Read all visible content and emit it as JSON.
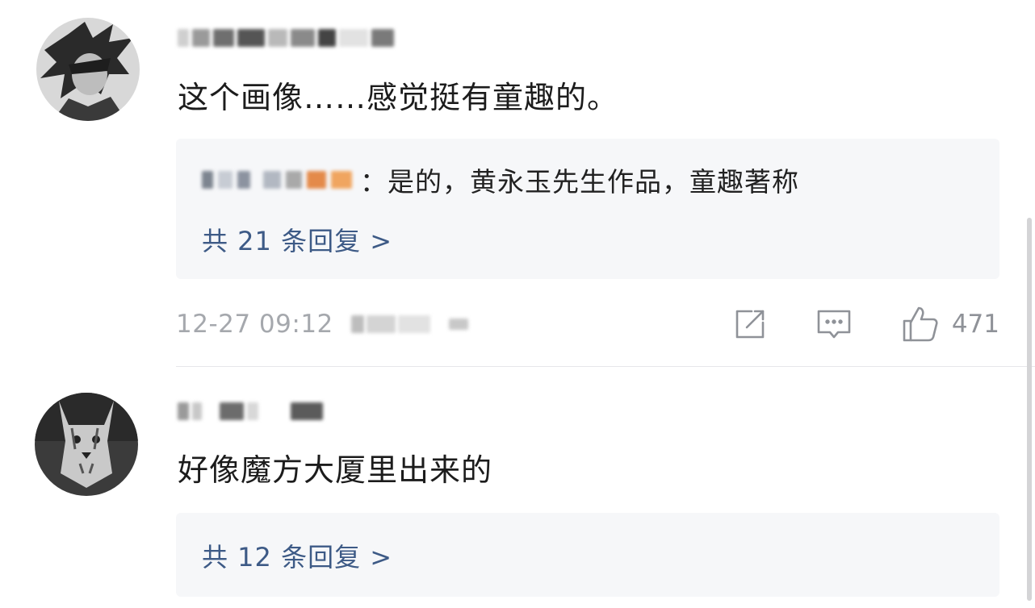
{
  "comments": [
    {
      "text": "这个画像……感觉挺有童趣的。",
      "reply": {
        "text": "：是的，黄永玉先生作品，童趣著称",
        "count_label": "共 21 条回复 >"
      },
      "meta": {
        "timestamp": "12-27 09:12",
        "likes": "471"
      }
    },
    {
      "text": "好像魔方大厦里出来的",
      "reply": {
        "count_label": "共 12 条回复 >"
      }
    }
  ],
  "icons": {
    "share": "share-icon",
    "comment": "comment-icon",
    "like": "thumbs-up-icon"
  },
  "colors": {
    "reply_link": "#3d5a86",
    "meta_gray": "#a5a8ad",
    "reply_bg": "#f6f7f9"
  }
}
